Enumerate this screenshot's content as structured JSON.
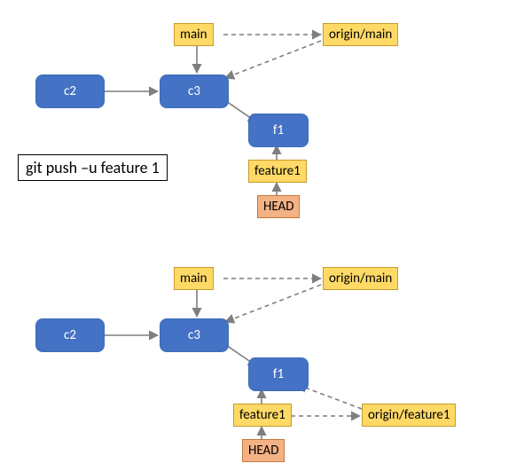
{
  "command": "git push –u feature 1",
  "top": {
    "commits": {
      "c2": "c2",
      "c3": "c3",
      "f1": "f1"
    },
    "refs": {
      "main": "main",
      "origin_main": "origin/main",
      "feature1": "feature1",
      "head": "HEAD"
    }
  },
  "bottom": {
    "commits": {
      "c2": "c2",
      "c3": "c3",
      "f1": "f1"
    },
    "refs": {
      "main": "main",
      "origin_main": "origin/main",
      "feature1": "feature1",
      "origin_feature1": "origin/feature1",
      "head": "HEAD"
    }
  },
  "colors": {
    "commit": "#4472c4",
    "ref": "#ffd966",
    "head": "#f4b183"
  }
}
